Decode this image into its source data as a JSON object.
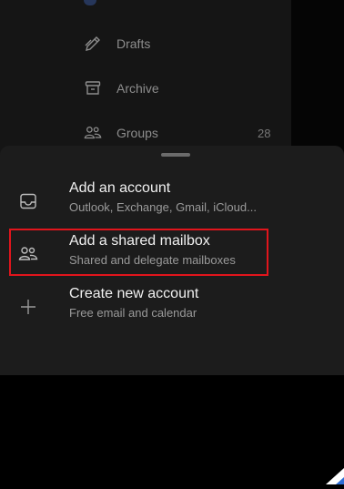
{
  "drawer": {
    "items": [
      {
        "label": "Drafts",
        "icon": "pencil-icon"
      },
      {
        "label": "Archive",
        "icon": "archive-box-icon"
      },
      {
        "label": "Groups",
        "icon": "people-group-icon",
        "count": "28"
      }
    ]
  },
  "sheet": {
    "options": [
      {
        "title": "Add an account",
        "subtitle": "Outlook, Exchange, Gmail, iCloud...",
        "icon": "inbox-tray-icon"
      },
      {
        "title": "Add a shared mailbox",
        "subtitle": "Shared and delegate mailboxes",
        "icon": "shared-people-icon",
        "highlighted": true
      },
      {
        "title": "Create new account",
        "subtitle": "Free email and calendar",
        "icon": "plus-icon"
      }
    ]
  },
  "colors": {
    "highlight": "#e1151c",
    "sheet_bg": "#1c1c1c",
    "accent": "#2f6fd6"
  }
}
